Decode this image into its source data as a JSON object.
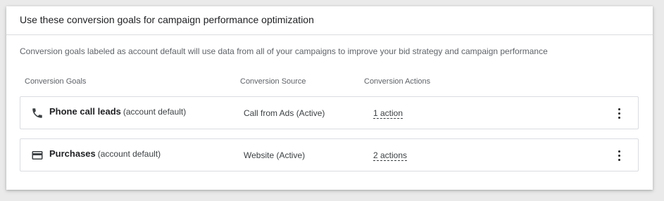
{
  "card": {
    "title": "Use these conversion goals for campaign performance optimization",
    "description": "Conversion goals labeled as account default will use data from all of your campaigns to improve your bid strategy and campaign performance"
  },
  "columns": {
    "goals": "Conversion Goals",
    "source": "Conversion Source",
    "actions": "Conversion Actions"
  },
  "rows": [
    {
      "icon": "phone-icon",
      "name": "Phone call leads",
      "tag": "(account default)",
      "source": "Call from Ads (Active)",
      "actions": "1 action"
    },
    {
      "icon": "credit-card-icon",
      "name": "Purchases",
      "tag": "(account default)",
      "source": "Website (Active)",
      "actions": "2 actions"
    }
  ],
  "icons": {
    "more": "more-vert-icon"
  },
  "colors": {
    "page_bg": "#eaeaea",
    "card_bg": "#ffffff",
    "border": "#dadce0",
    "text_primary": "#202124",
    "text_secondary": "#5f6368"
  }
}
